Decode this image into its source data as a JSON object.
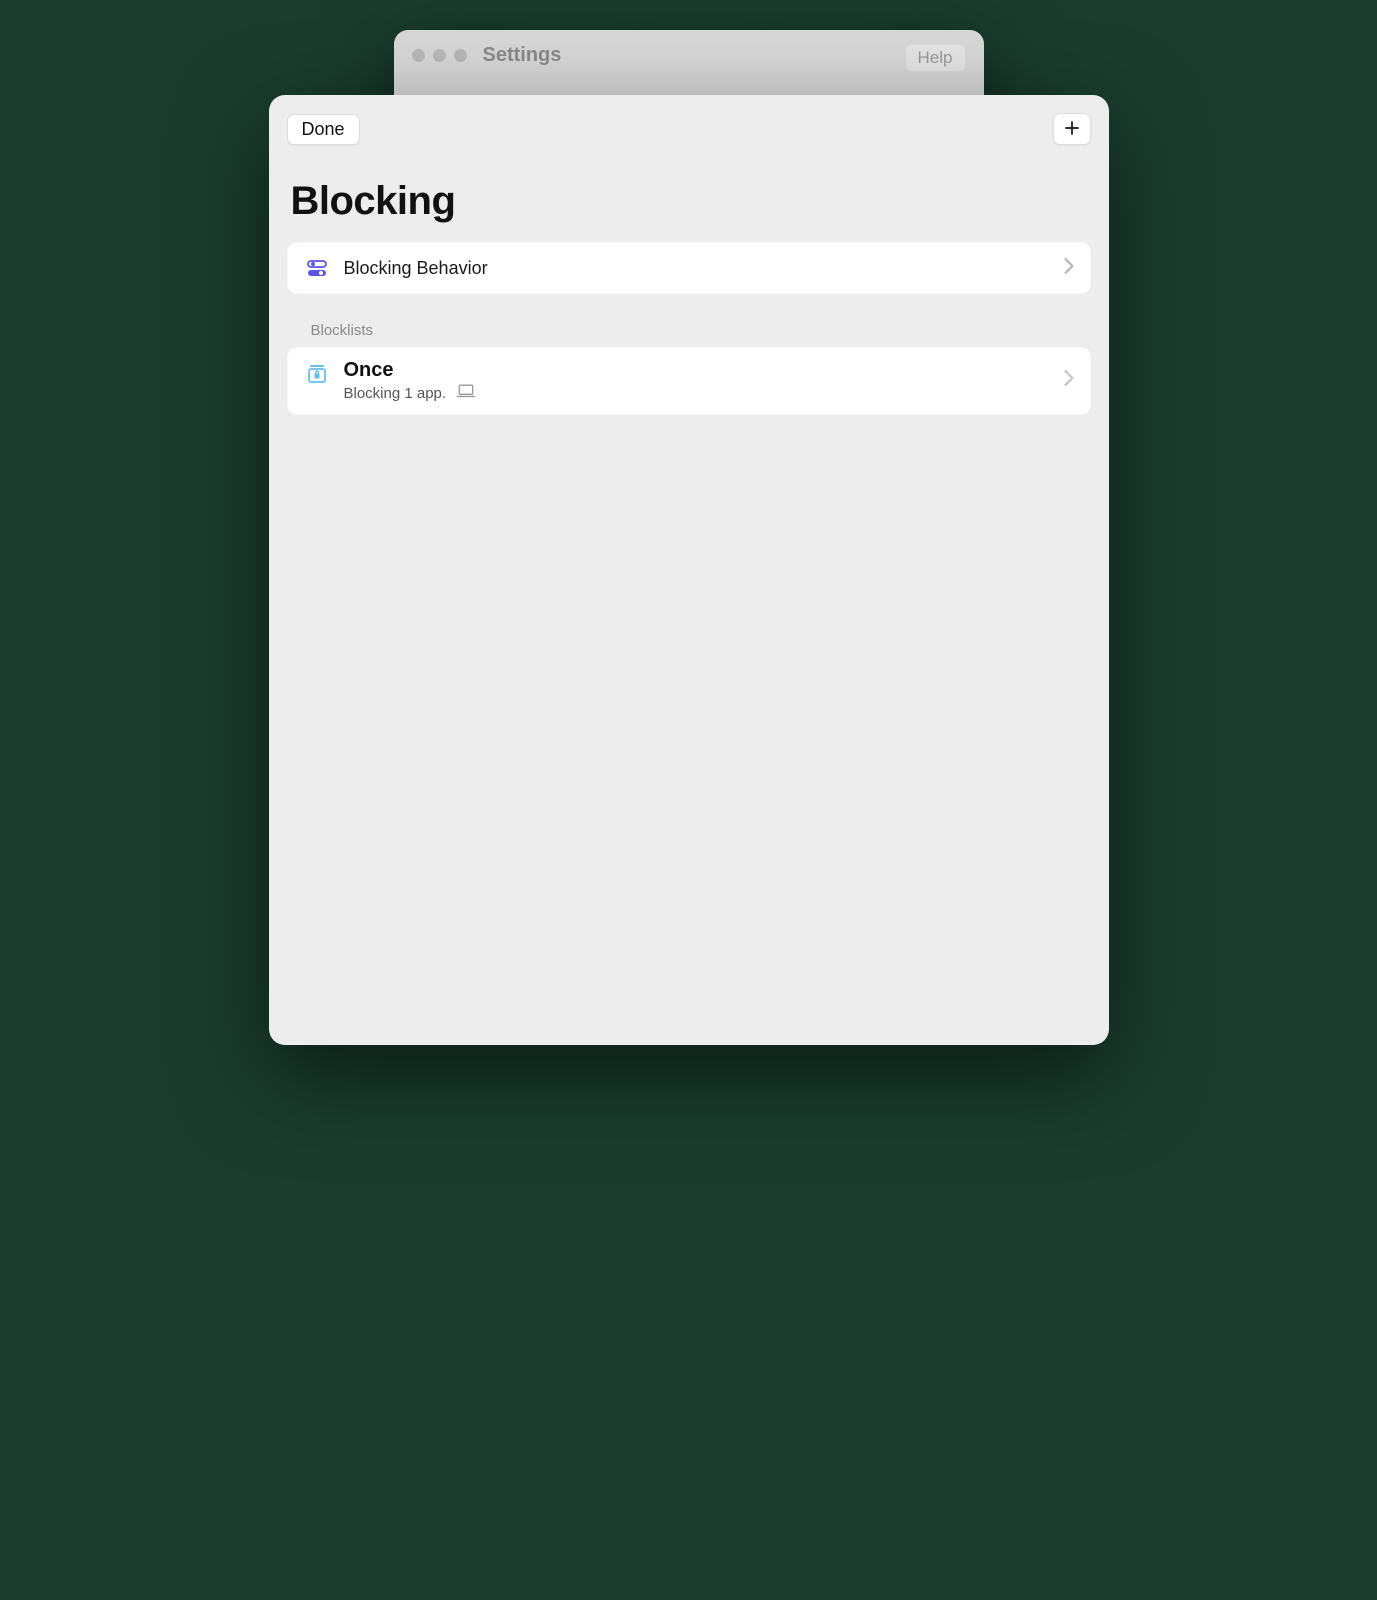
{
  "back_window": {
    "title": "Settings",
    "help_label": "Help"
  },
  "panel": {
    "done_label": "Done",
    "page_title": "Blocking",
    "behavior_row": {
      "label": "Blocking Behavior"
    },
    "blocklists_section_label": "Blocklists",
    "blocklists": [
      {
        "name": "Once",
        "subtitle": "Blocking 1 app."
      }
    ]
  }
}
